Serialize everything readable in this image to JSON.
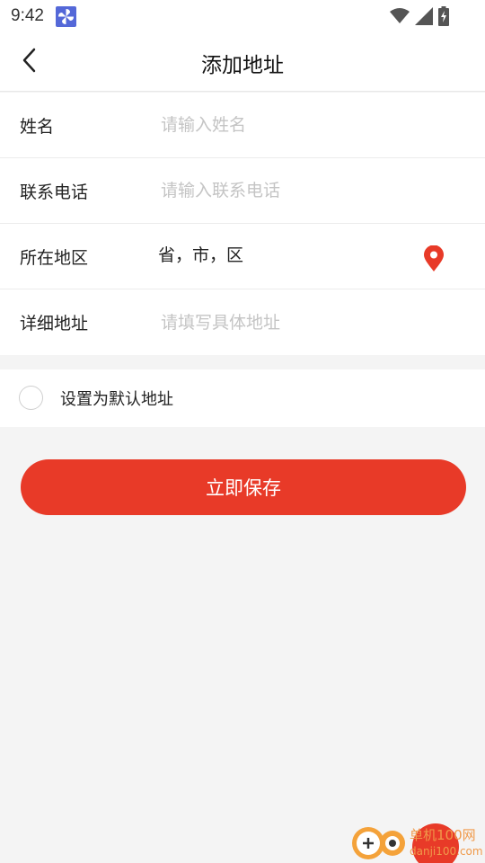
{
  "status_bar": {
    "time": "9:42",
    "icons": [
      "pinwheel-app-icon",
      "wifi-icon",
      "signal-icon",
      "battery-charging-icon"
    ]
  },
  "header": {
    "title": "添加地址",
    "back_icon": "chevron-left-icon"
  },
  "form": {
    "name": {
      "label": "姓名",
      "placeholder": "请输入姓名",
      "value": ""
    },
    "phone": {
      "label": "联系电话",
      "placeholder": "请输入联系电话",
      "value": ""
    },
    "region": {
      "label": "所在地区",
      "value": "省，市，区",
      "icon": "location-pin-icon"
    },
    "detail": {
      "label": "详细地址",
      "placeholder": "请填写具体地址",
      "value": ""
    }
  },
  "default_address": {
    "label": "设置为默认地址",
    "checked": false
  },
  "save_button": {
    "label": "立即保存"
  },
  "watermark": {
    "text": "单机100网",
    "url": "danji100.com"
  },
  "colors": {
    "accent": "#e83a28",
    "background": "#f4f4f4",
    "placeholder": "#c4c4c4"
  }
}
